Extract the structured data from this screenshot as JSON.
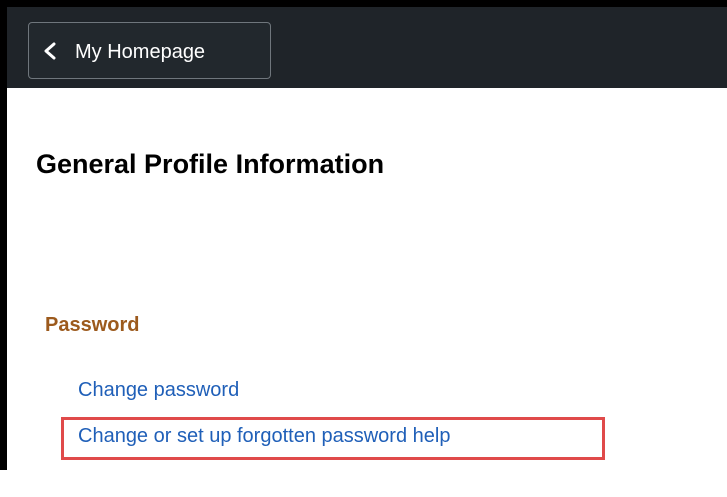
{
  "header": {
    "back_label": "My Homepage",
    "back_icon": "chevron-left-icon"
  },
  "page": {
    "title": "General Profile Information"
  },
  "password_section": {
    "title": "Password",
    "links": [
      {
        "label": "Change password"
      },
      {
        "label": "Change or set up forgotten password help"
      }
    ]
  },
  "colors": {
    "header_bg": "#1f2429",
    "section_title": "#9c5a1d",
    "link": "#1f5fb8",
    "highlight": "#e04a4a"
  }
}
